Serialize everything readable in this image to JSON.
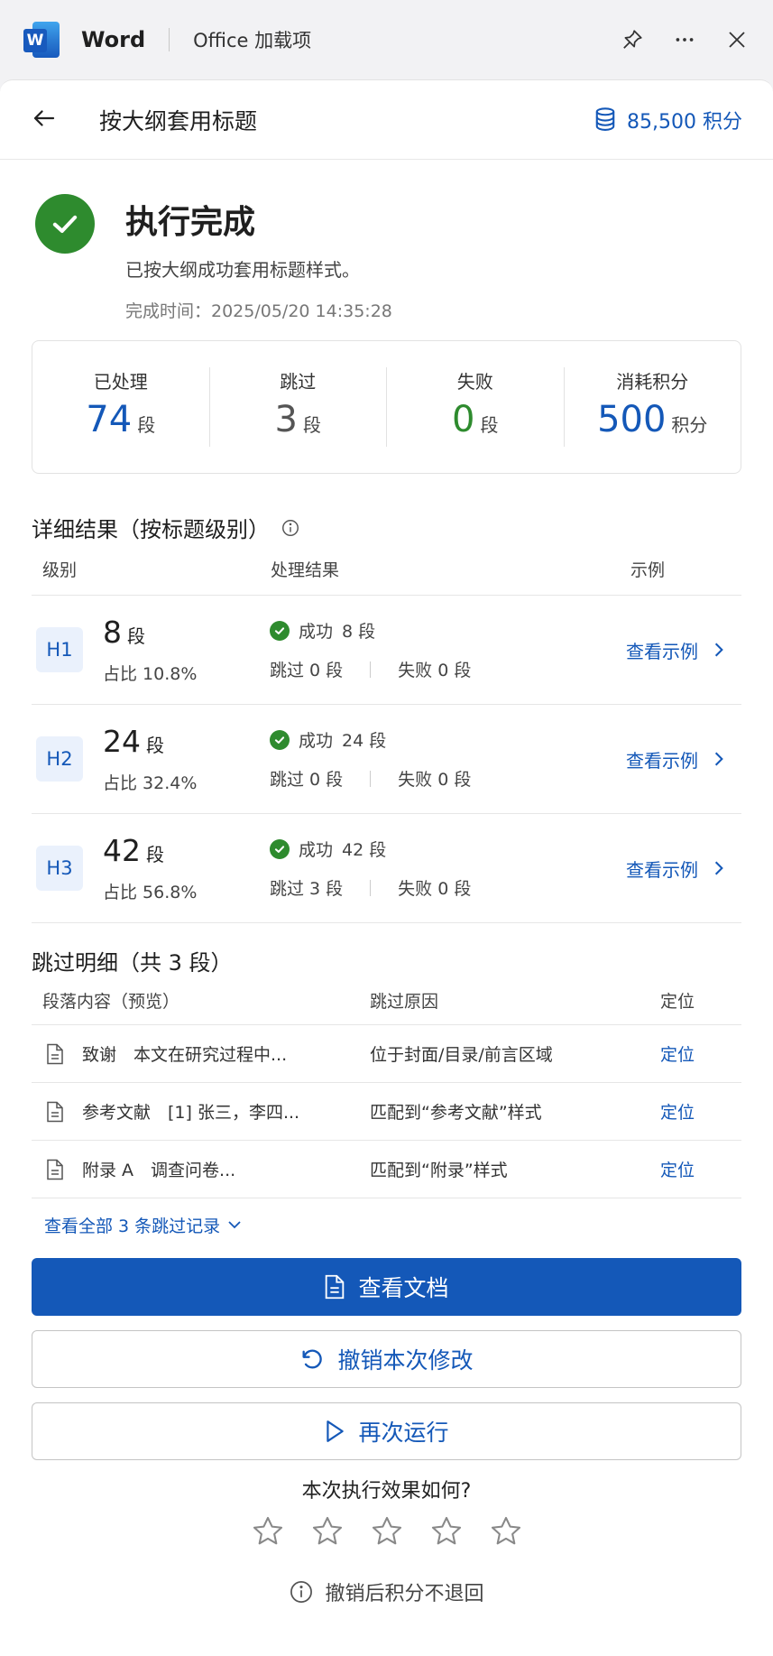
{
  "titlebar": {
    "logo_letter": "W",
    "app_name": "Word",
    "addin_name": "Office 加载项"
  },
  "header": {
    "title": "按大纲套用标题",
    "points": "85,500 积分"
  },
  "result": {
    "title": "执行完成",
    "desc": "已按大纲成功套用标题样式。",
    "time": "完成时间：2025/05/20 14:35:28"
  },
  "stats": [
    {
      "label": "已处理",
      "value": "74",
      "unit": "段",
      "color": "#1458b8"
    },
    {
      "label": "跳过",
      "value": "3",
      "unit": "段",
      "color": "#555555"
    },
    {
      "label": "失败",
      "value": "0",
      "unit": "段",
      "color": "#2e8b2e"
    },
    {
      "label": "消耗积分",
      "value": "500",
      "unit": "积分",
      "color": "#1458b8"
    }
  ],
  "details": {
    "title": "详细结果（按标题级别）",
    "headers": {
      "level": "级别",
      "result": "处理结果",
      "example": "示例"
    },
    "rows": [
      {
        "level": "H1",
        "count": "8",
        "unit": "段",
        "pct": "占比 10.8%",
        "success_label": "成功",
        "success": "8 段",
        "skipped": "跳过 0 段",
        "failed": "失败 0 段",
        "link": "查看示例"
      },
      {
        "level": "H2",
        "count": "24",
        "unit": "段",
        "pct": "占比 32.4%",
        "success_label": "成功",
        "success": "24 段",
        "skipped": "跳过 0 段",
        "failed": "失败 0 段",
        "link": "查看示例"
      },
      {
        "level": "H3",
        "count": "42",
        "unit": "段",
        "pct": "占比 56.8%",
        "success_label": "成功",
        "success": "42 段",
        "skipped": "跳过 3 段",
        "failed": "失败 0 段",
        "link": "查看示例"
      }
    ]
  },
  "skips": {
    "title": "跳过明细（共 3 段）",
    "headers": {
      "content": "段落内容（预览）",
      "reason": "跳过原因",
      "locate": "定位"
    },
    "rows": [
      {
        "content": "致谢　本文在研究过程中...",
        "reason": "位于封面/目录/前言区域",
        "locate": "定位"
      },
      {
        "content": "参考文献　[1] 张三，李四...",
        "reason": "匹配到“参考文献”样式",
        "locate": "定位"
      },
      {
        "content": "附录 A　调查问卷...",
        "reason": "匹配到“附录”样式",
        "locate": "定位"
      }
    ],
    "view_all": "查看全部 3 条跳过记录"
  },
  "buttons": {
    "view_doc": "查看文档",
    "undo": "撤销本次修改",
    "rerun": "再次运行"
  },
  "rating": {
    "question": "本次执行效果如何?",
    "stars_total": 5,
    "stars_selected": 0
  },
  "note": "撤销后积分不退回",
  "icons": [
    "word-logo",
    "pin-icon",
    "more-icon",
    "close-icon",
    "back-arrow-icon",
    "coins-icon",
    "check-circle-icon",
    "info-icon",
    "document-icon",
    "chevron-right-icon",
    "chevron-down-icon",
    "undo-icon",
    "play-icon",
    "star-icon"
  ]
}
